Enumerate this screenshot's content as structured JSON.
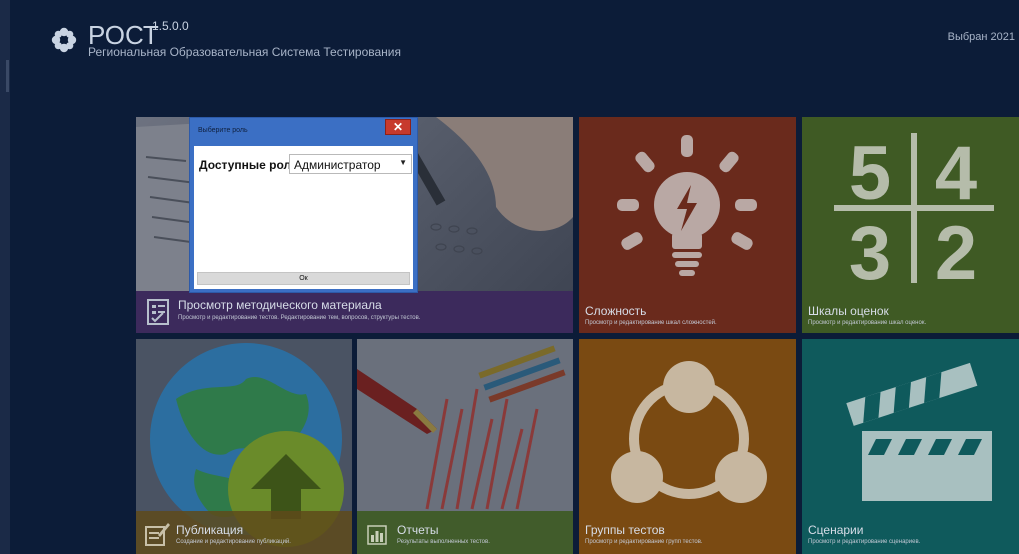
{
  "header": {
    "brand": "РОСТ",
    "version": "1.5.0.0",
    "subtitle": "Региональная Образовательная Система Тестирования",
    "selected_year": "Выбран 2021"
  },
  "tiles": {
    "method": {
      "title": "Просмотр методического материала",
      "desc": "Просмотр и редактирование тестов. Редактирование тем, вопросов, структуры тестов."
    },
    "slozh": {
      "title": "Сложность",
      "desc": "Просмотр и редактирование шкал сложностей."
    },
    "shkaly": {
      "title": "Шкалы оценок",
      "desc": "Просмотр и редактирование шкал оценок.",
      "digits": [
        "5",
        "4",
        "3",
        "2"
      ]
    },
    "pub": {
      "title": "Публикация",
      "desc": "Создание и редактирование публикаций."
    },
    "otch": {
      "title": "Отчеты",
      "desc": "Результаты выполненных тестов."
    },
    "grp": {
      "title": "Группы тестов",
      "desc": "Просмотр и редактирование групп тестов."
    },
    "scen": {
      "title": "Сценарии",
      "desc": "Просмотр и редактирование сценариев."
    }
  },
  "dialog": {
    "title": "Выберите роль",
    "close_label": "✕",
    "roles_label": "Доступные роли:",
    "selected_role": "Администратор",
    "ok_label": "Ок"
  },
  "colors": {
    "background": "#0c1c38",
    "method_footer": "#3c2a5c",
    "slozh": "#6a2a1c",
    "shkaly": "#3f5a24",
    "grp": "#7a4a12",
    "scen": "#0f5a5c",
    "dialog_frame": "#3b6fc4",
    "close": "#c73a2d"
  }
}
